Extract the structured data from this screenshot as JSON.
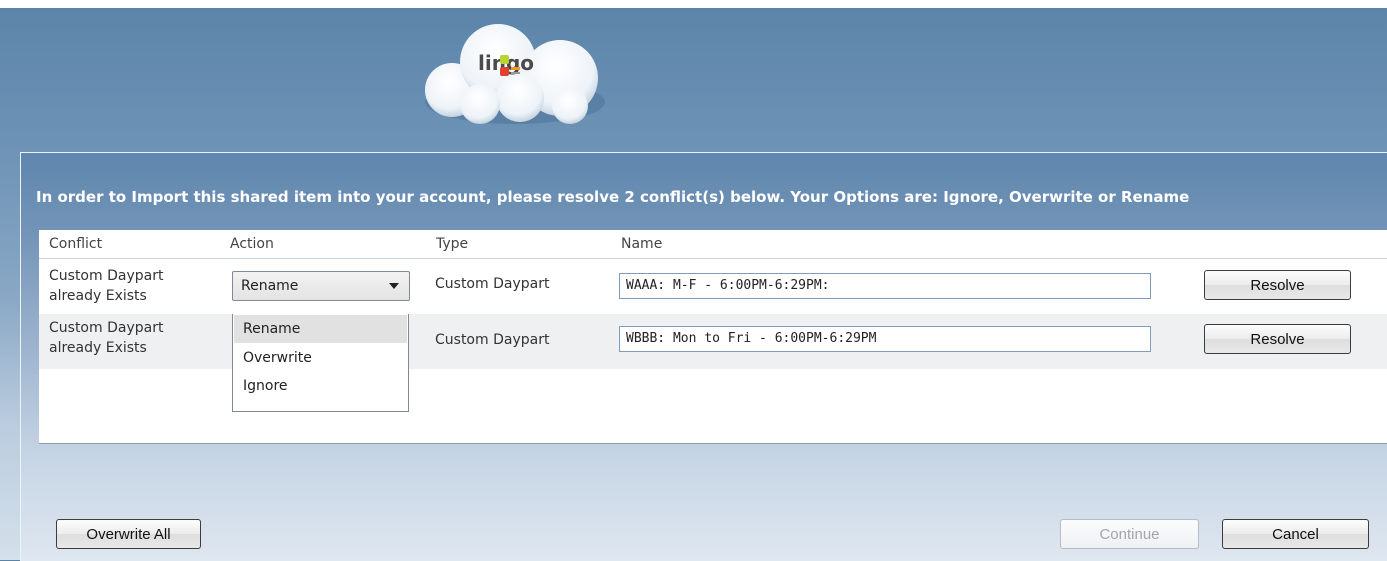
{
  "brand": {
    "logo_text": "lingo"
  },
  "dialog": {
    "instruction": "In order to Import this shared item into your account, please resolve 2 conflict(s) below. Your Options are: Ignore, Overwrite or Rename"
  },
  "table": {
    "columns": [
      "Conflict",
      "Action",
      "Type",
      "Name"
    ],
    "rows": [
      {
        "conflict": "Custom Daypart already Exists",
        "action": "Rename",
        "type": "Custom Daypart",
        "name": "WAAA: M-F - 6:00PM-6:29PM:",
        "resolve_label": "Resolve"
      },
      {
        "conflict": "Custom Daypart already Exists",
        "action": "",
        "type": "Custom Daypart",
        "name": "WBBB: Mon to Fri - 6:00PM-6:29PM",
        "resolve_label": "Resolve"
      }
    ]
  },
  "action_dropdown": {
    "options": [
      "Rename",
      "Overwrite",
      "Ignore"
    ],
    "selected": "Rename"
  },
  "footer": {
    "overwrite_all_label": "Overwrite All",
    "continue_label": "Continue",
    "cancel_label": "Cancel"
  },
  "colors": {
    "header_bg": "#5b84a9",
    "title_text": "#ffffff",
    "grid_bg": "#ffffff",
    "row_alt_bg": "#eef0f2",
    "logo_green": "#b8d432",
    "logo_red": "#e1402a",
    "logo_orange": "#f19a22"
  }
}
